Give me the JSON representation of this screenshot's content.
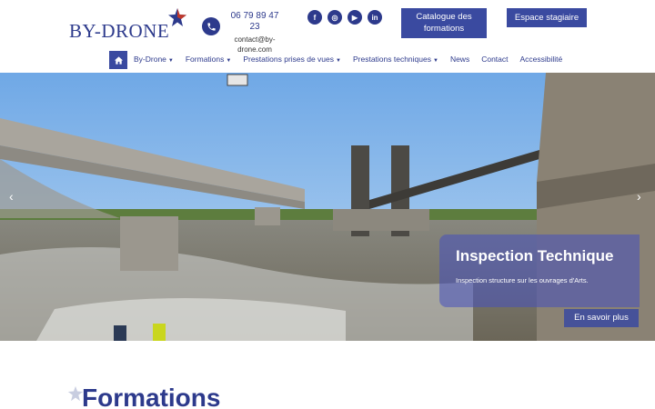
{
  "header": {
    "logo_text": "BY-DRONE",
    "phone": "06 79 89 47 23",
    "email": "contact@by-drone.com",
    "email_line1": "contact@by-",
    "email_line2": "drone.com",
    "socials": [
      {
        "name": "facebook-icon",
        "glyph": "f"
      },
      {
        "name": "instagram-icon",
        "glyph": "◎"
      },
      {
        "name": "youtube-icon",
        "glyph": "▶"
      },
      {
        "name": "linkedin-icon",
        "glyph": "in"
      }
    ],
    "catalogue_label": "Catalogue des formations",
    "espace_label": "Espace stagiaire"
  },
  "nav": {
    "items": [
      {
        "label": "By-Drone",
        "dropdown": true
      },
      {
        "label": "Formations",
        "dropdown": true
      },
      {
        "label": "Prestations prises de vues",
        "dropdown": true
      },
      {
        "label": "Prestations techniques",
        "dropdown": true
      },
      {
        "label": "News",
        "dropdown": false
      },
      {
        "label": "Contact",
        "dropdown": false
      },
      {
        "label": "Accessibilité",
        "dropdown": false
      }
    ]
  },
  "hero": {
    "title": "Inspection Technique",
    "subtitle": "Inspection structure sur les ouvrages d'Arts.",
    "cta": "En savoir plus",
    "prev": "‹",
    "next": "›"
  },
  "section": {
    "title": "Formations"
  },
  "colors": {
    "brand": "#2d3a8c",
    "button": "#3a4aa0"
  }
}
